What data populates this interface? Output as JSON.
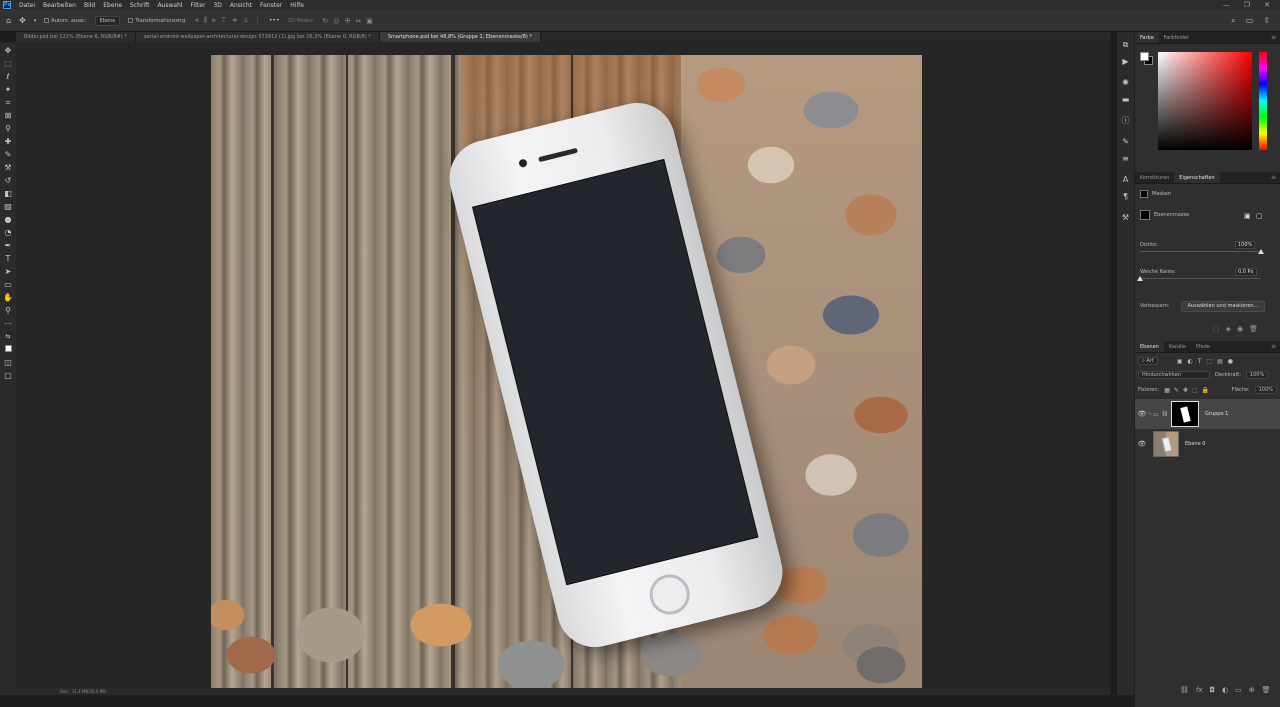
{
  "menubar": {
    "logo": "Ps",
    "items": [
      "Datei",
      "Bearbeiten",
      "Bild",
      "Ebene",
      "Schrift",
      "Auswahl",
      "Filter",
      "3D",
      "Ansicht",
      "Fenster",
      "Hilfe"
    ],
    "window_controls": [
      "—",
      "❐",
      "✕"
    ]
  },
  "options": {
    "auto_select_label": "Autom. ausw.:",
    "auto_select_target": "Ebene",
    "transform_label": "Transformationsstrg.",
    "mode_3d_label": "3D-Modus:",
    "more": "•••"
  },
  "tabs": [
    {
      "label": "Bilder.psd bei 121% (Ebene 6, RGB/8#) *",
      "active": false
    },
    {
      "label": "aerial-android-wallpaper-architectural-design-373912 (1).jpg bei 26,3% (Ebene 0, RGB/8) *",
      "active": false
    },
    {
      "label": "Smartphone.psd bei 48,8% (Gruppe 1, Ebenenmaske/8) *",
      "active": true
    }
  ],
  "color_panel": {
    "tabs": [
      "Farbe",
      "Farbfelder"
    ],
    "foreground": "#ffffff",
    "background": "#000000"
  },
  "properties_panel": {
    "tabs": [
      "Korrekturen",
      "Eigenschaften"
    ],
    "section": "Masken",
    "mask_type": "Ebenenmaske",
    "density_label": "Dichte:",
    "density_value": "100%",
    "density_fraction": 1.0,
    "feather_label": "Weiche Kante:",
    "feather_value": "0,0 Px",
    "feather_fraction": 0.0,
    "refine_label": "Verbessern:",
    "refine_button": "Auswählen und maskieren..."
  },
  "layers_panel": {
    "tabs": [
      "Ebenen",
      "Kanäle",
      "Pfade"
    ],
    "filter_kind": "Art",
    "blend_mode": "Hindurchwirken",
    "opacity_label": "Deckkraft:",
    "opacity_value": "100%",
    "lock_label": "Fixieren:",
    "fill_label": "Fläche:",
    "fill_value": "100%",
    "layers": [
      {
        "name": "Gruppe 1",
        "selected": true
      },
      {
        "name": "Ebene 0",
        "selected": false
      }
    ]
  },
  "status": {
    "doc_info": "Dok.: 11,4 MB/26,0 MB"
  }
}
